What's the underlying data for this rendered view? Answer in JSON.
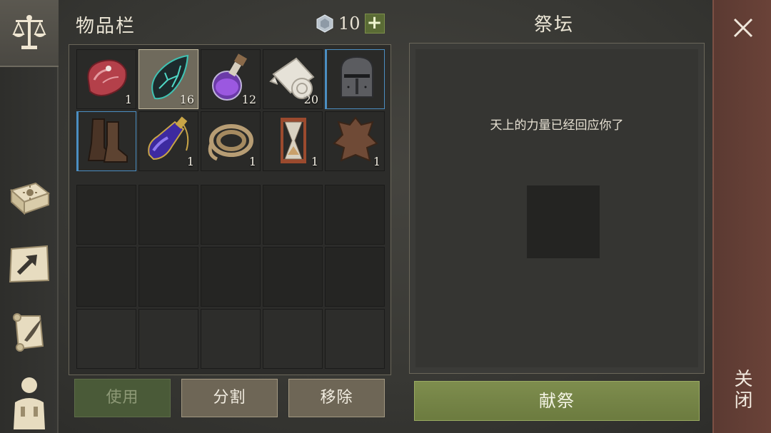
{
  "inventory": {
    "title": "物品栏",
    "currency": {
      "icon": "crystal-gem-icon",
      "value": "10",
      "add_label": "+"
    },
    "slots": [
      {
        "icon": "raw-meat-icon",
        "count": "1"
      },
      {
        "icon": "dark-shard-icon",
        "count": "16",
        "selected": true
      },
      {
        "icon": "purple-potion-icon",
        "count": "12"
      },
      {
        "icon": "cloth-roll-icon",
        "count": "20"
      },
      {
        "icon": "knight-helmet-icon",
        "count": ""
      },
      {
        "icon": "leather-boots-icon",
        "count": ""
      },
      {
        "icon": "elixir-bottle-icon",
        "count": "1"
      },
      {
        "icon": "rope-coil-icon",
        "count": "1"
      },
      {
        "icon": "hourglass-icon",
        "count": "1"
      },
      {
        "icon": "animal-hide-icon",
        "count": "1"
      }
    ],
    "buttons": {
      "use": "使用",
      "split": "分割",
      "remove": "移除"
    }
  },
  "altar": {
    "title": "祭坛",
    "message": "天上的力量已经回应你了",
    "sacrifice_label": "献祭"
  },
  "close": {
    "label": "关闭"
  },
  "sidebar": {
    "tabs": [
      "scales-icon",
      "sun-book-icon",
      "map-arrow-icon",
      "scroll-quill-icon",
      "character-icon"
    ]
  },
  "colors": {
    "accent_green": "#7e8d4e",
    "close_bar": "#6a4238",
    "rare_border": "#4b8ec2"
  }
}
